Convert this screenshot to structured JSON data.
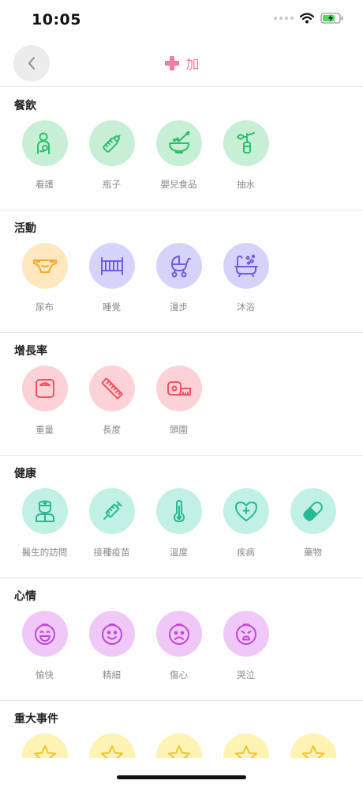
{
  "status_bar": {
    "time": "10:05"
  },
  "nav": {
    "title": "加"
  },
  "sections": [
    {
      "title": "餐飲",
      "color": "green",
      "items": [
        {
          "label": "看護",
          "icon": "nursing-icon"
        },
        {
          "label": "瓶子",
          "icon": "bottle-icon"
        },
        {
          "label": "嬰兒食品",
          "icon": "baby-food-icon"
        },
        {
          "label": "抽水",
          "icon": "breast-pump-icon"
        }
      ]
    },
    {
      "title": "活動",
      "color": "orange-purple",
      "items": [
        {
          "label": "尿布",
          "icon": "diaper-icon"
        },
        {
          "label": "睡覺",
          "icon": "crib-icon"
        },
        {
          "label": "漫步",
          "icon": "stroller-icon"
        },
        {
          "label": "沐浴",
          "icon": "bathtub-icon"
        }
      ]
    },
    {
      "title": "增長率",
      "color": "pink",
      "items": [
        {
          "label": "重量",
          "icon": "scale-icon"
        },
        {
          "label": "長度",
          "icon": "ruler-icon"
        },
        {
          "label": "頭圍",
          "icon": "tape-measure-icon"
        }
      ]
    },
    {
      "title": "健康",
      "color": "teal",
      "items": [
        {
          "label": "醫生的訪問",
          "icon": "doctor-icon"
        },
        {
          "label": "接種疫苗",
          "icon": "syringe-icon"
        },
        {
          "label": "溫度",
          "icon": "thermometer-icon"
        },
        {
          "label": "疾病",
          "icon": "heart-plus-icon"
        },
        {
          "label": "藥物",
          "icon": "pill-icon"
        }
      ]
    },
    {
      "title": "心情",
      "color": "violet",
      "items": [
        {
          "label": "愉快",
          "icon": "happy-face-icon"
        },
        {
          "label": "精細",
          "icon": "smile-face-icon"
        },
        {
          "label": "傷心",
          "icon": "sad-face-icon"
        },
        {
          "label": "哭泣",
          "icon": "crying-face-icon"
        }
      ]
    },
    {
      "title": "重大事件",
      "color": "yellow",
      "items": [
        {
          "label": "",
          "icon": "star-icon"
        },
        {
          "label": "",
          "icon": "star-icon"
        },
        {
          "label": "",
          "icon": "star-icon"
        },
        {
          "label": "",
          "icon": "star-icon"
        },
        {
          "label": "",
          "icon": "star-icon"
        }
      ]
    }
  ],
  "colors": {
    "accent_pink": "#ee7ea1",
    "green": "#2ebf6c",
    "orange": "#f3a92b",
    "purple": "#6c5fe6",
    "pink": "#f0525f",
    "teal": "#27b997",
    "violet": "#c147db",
    "yellow": "#ecc62c"
  }
}
